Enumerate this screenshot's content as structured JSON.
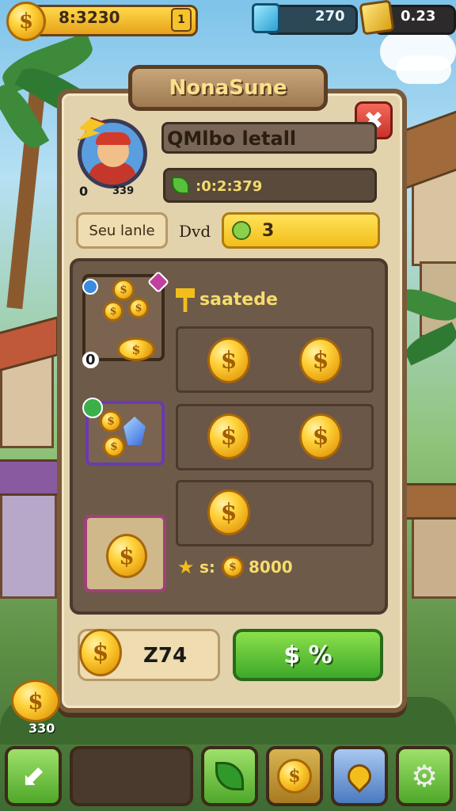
{
  "hud": {
    "coins_value": "8:3230",
    "coins_badge": "1",
    "gems_value": "270",
    "gold_value": "0.23"
  },
  "panel": {
    "title": "NonaSune",
    "player_name": "QMlbo letall",
    "avatar_level_left": "0",
    "avatar_level_right": "339",
    "xp_value": ":0:2:379",
    "tab_button": "Seu lanle",
    "label_dvd": "Dvd",
    "currency_amount": "3",
    "section_title": "saatede",
    "row1_badge": "0",
    "reward_text": "s:",
    "reward_amount": "8000",
    "buy_amount": "Z74",
    "buy_button": "$ %"
  },
  "side_counter": "330",
  "icons": {
    "close": "close-icon",
    "bolt": "bolt-icon",
    "leaf": "leaf-icon",
    "gear": "gear-icon",
    "arrow": "arrow-icon",
    "coin": "coin-icon"
  },
  "colors": {
    "accent_green": "#56c23a",
    "gold": "#ffd23a",
    "panel_bg": "#e2d3ad",
    "close_red": "#e0483a"
  }
}
